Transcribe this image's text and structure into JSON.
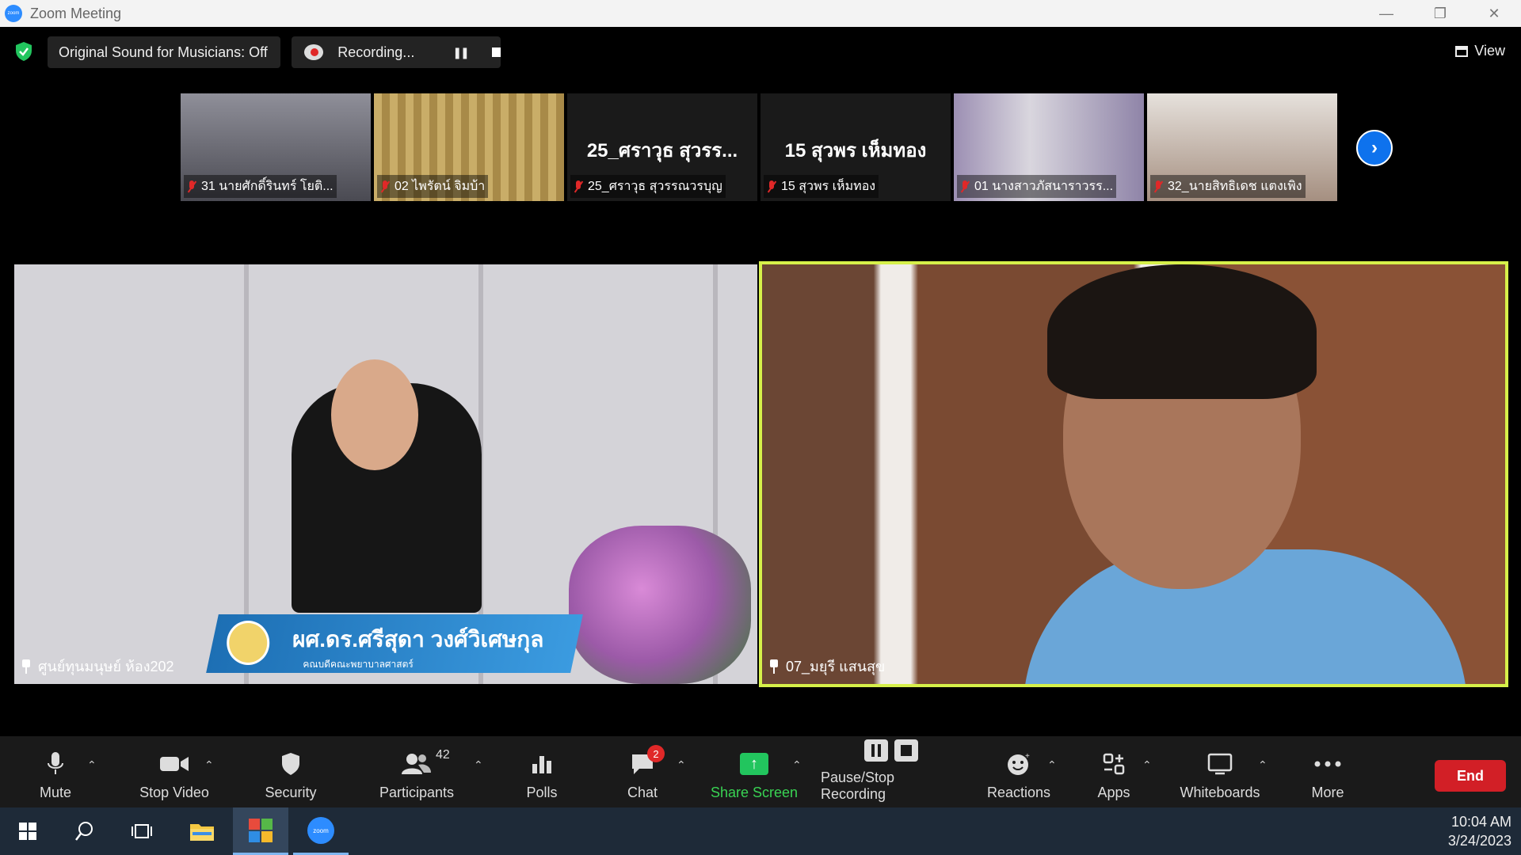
{
  "window": {
    "title": "Zoom Meeting"
  },
  "status": {
    "sound_label": "Original Sound for Musicians: Off",
    "recording_label": "Recording...",
    "view_label": "View",
    "shield_color": "#22c55e"
  },
  "thumbnails": [
    {
      "name": "31 นายศักดิ์รินทร์  โยติ...",
      "big_name": "",
      "bg": "#6b6b73"
    },
    {
      "name": "02 ไพรัตน์  จิมบ้า",
      "big_name": "",
      "bg": "#b79a55"
    },
    {
      "name": "25_ศราวุธ สุวรรณวรบุญ",
      "big_name": "25_ศราวุธ สุวรร...",
      "bg": "#1a1a1a"
    },
    {
      "name": "15 สุวพร เห็มทอง",
      "big_name": "15 สุวพร เห็มทอง",
      "bg": "#1a1a1a"
    },
    {
      "name": "01 นางสาวภัสนาราวรร...",
      "big_name": "",
      "bg": "#8a7f9a"
    },
    {
      "name": "32_นายสิทธิเดช  แตงเพิง",
      "big_name": "",
      "bg": "#c2b8b0"
    }
  ],
  "main": {
    "left_label": "ศูนย์ทุนมนุษย์ ห้อง202",
    "right_label": "07_มยุรี แสนสุข",
    "lower_third_name": "ผศ.ดร.ศรีสุดา วงศ์วิเศษกุล",
    "lower_third_sub": "คณบดีคณะพยาบาลศาสตร์"
  },
  "toolbar": {
    "mute": "Mute",
    "stop_video": "Stop Video",
    "security": "Security",
    "participants": "Participants",
    "participants_count": "42",
    "polls": "Polls",
    "chat": "Chat",
    "chat_badge": "2",
    "share_screen": "Share Screen",
    "pause_stop_recording": "Pause/Stop Recording",
    "reactions": "Reactions",
    "apps": "Apps",
    "whiteboards": "Whiteboards",
    "more": "More",
    "end": "End",
    "end_color": "#d21f26",
    "share_color": "#22c55e"
  },
  "taskbar": {
    "time": "10:04 AM",
    "date": "3/24/2023"
  }
}
